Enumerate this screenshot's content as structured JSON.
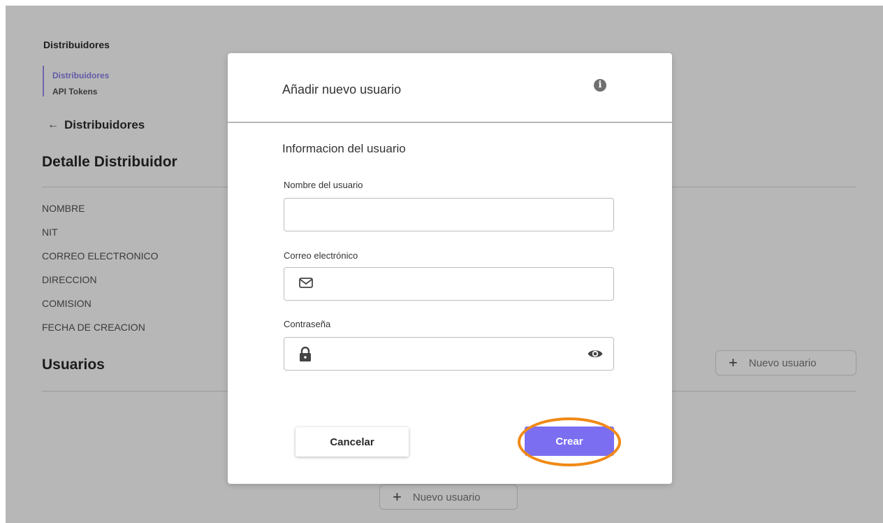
{
  "sidebar": {
    "section_title": "Distribuidores",
    "items": [
      {
        "label": "Distribuidores",
        "active": true
      },
      {
        "label": "API Tokens",
        "active": false
      }
    ]
  },
  "back_link": {
    "label": "Distribuidores",
    "icon": "arrow-left-icon"
  },
  "detail": {
    "title": "Detalle Distribuidor",
    "fields": [
      "NOMBRE",
      "NIT",
      "CORREO ELECTRONICO",
      "DIRECCION",
      "COMISION",
      "FECHA DE CREACION"
    ]
  },
  "users": {
    "title": "Usuarios",
    "new_user_label": "Nuevo usuario",
    "new_user_label_bottom": "Nuevo usuario"
  },
  "modal": {
    "title": "Añadir nuevo usuario",
    "info_icon": "info-icon",
    "section_title": "Informacion del usuario",
    "name_label": "Nombre del usuario",
    "name_value": "",
    "email_label": "Correo electrónico",
    "email_value": "",
    "email_icon": "mail-icon",
    "password_label": "Contraseña",
    "password_value": "",
    "password_icon": "lock-icon",
    "visibility_icon": "eye-icon",
    "cancel_label": "Cancelar",
    "create_label": "Crear"
  },
  "colors": {
    "accent": "#7c6ef1",
    "nav_active": "#625ca6",
    "highlight": "#f08a16",
    "overlay": "#b7b7b7"
  }
}
